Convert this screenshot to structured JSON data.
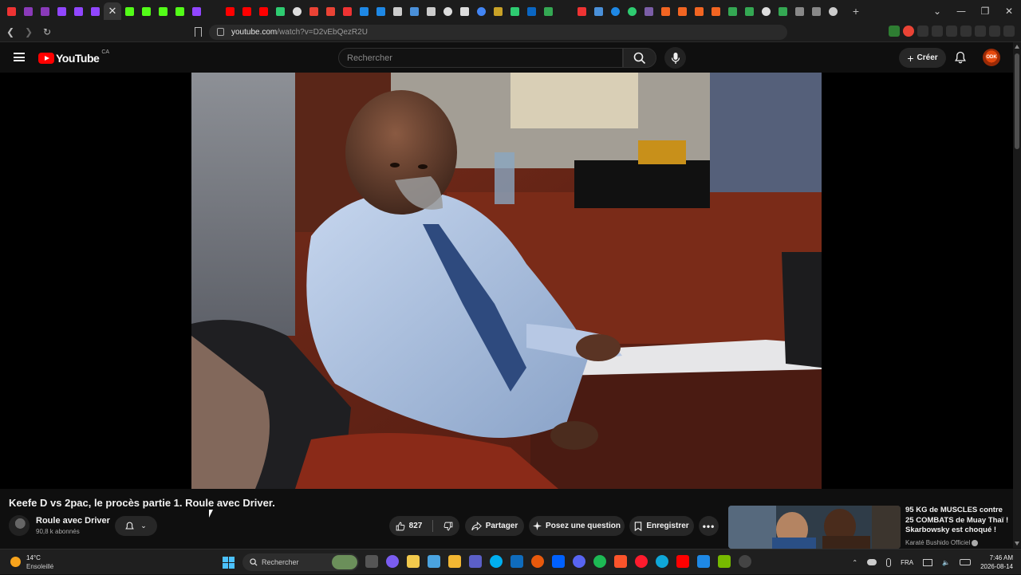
{
  "browser": {
    "url_host": "youtube.com",
    "url_path": "/watch?v=D2vEbQezR2U"
  },
  "header": {
    "logo_text": "YouTube",
    "country_code": "CA",
    "search_placeholder": "Rechercher",
    "create_label": "Créer",
    "avatar_text": "ODK"
  },
  "video": {
    "title": "Keefe D vs 2pac, le procès partie 1. Roule avec Driver."
  },
  "channel": {
    "name": "Roule avec Driver",
    "subscribers": "90,8 k abonnés"
  },
  "actions": {
    "likes": "827",
    "share_label": "Partager",
    "ask_label": "Posez une question",
    "save_label": "Enregistrer"
  },
  "recommended": {
    "title": "95 KG de MUSCLES contre 25 COMBATS de Muay Thaï ! Skarbowsky est choqué !",
    "channel": "Karaté Bushido Officiel"
  },
  "taskbar": {
    "temperature": "14°C",
    "weather": "Ensoleillé",
    "search_label": "Rechercher",
    "language": "FRA",
    "time": "7:46 AM",
    "date": "2026-08-14"
  },
  "colors": {
    "background": "#0f0f0f",
    "youtube_red": "#ff0000",
    "pill": "#272727"
  }
}
